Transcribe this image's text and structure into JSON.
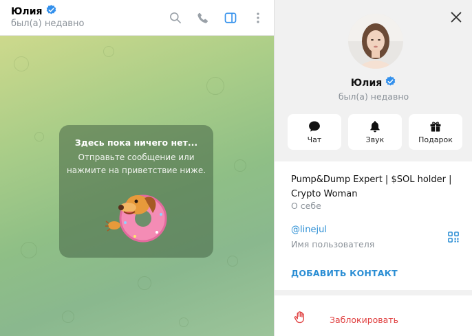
{
  "chat_header": {
    "name": "Юлия",
    "status": "был(а) недавно",
    "icons": [
      "search-icon",
      "phone-icon",
      "sidebar-toggle-icon",
      "more-vertical-icon"
    ]
  },
  "empty_state": {
    "title": "Здесь пока ничего нет...",
    "text": "Отправьте сообщение или нажмите на приветствие ниже."
  },
  "profile": {
    "name": "Юлия",
    "status": "был(а) недавно",
    "actions": [
      {
        "label": "Чат",
        "icon": "chat-icon"
      },
      {
        "label": "Звук",
        "icon": "bell-icon"
      },
      {
        "label": "Подарок",
        "icon": "gift-icon"
      }
    ],
    "bio": "Pump&Dump Expert | $SOL holder | Crypto Woman",
    "bio_label": "О себе",
    "username": "@linejul",
    "username_label": "Имя пользователя",
    "add_contact": "ДОБАВИТЬ КОНТАКТ",
    "block": "Заблокировать"
  },
  "colors": {
    "accent": "#2b8ed4",
    "danger": "#e04040",
    "verified": "#3390ec",
    "muted": "#8b9299"
  }
}
